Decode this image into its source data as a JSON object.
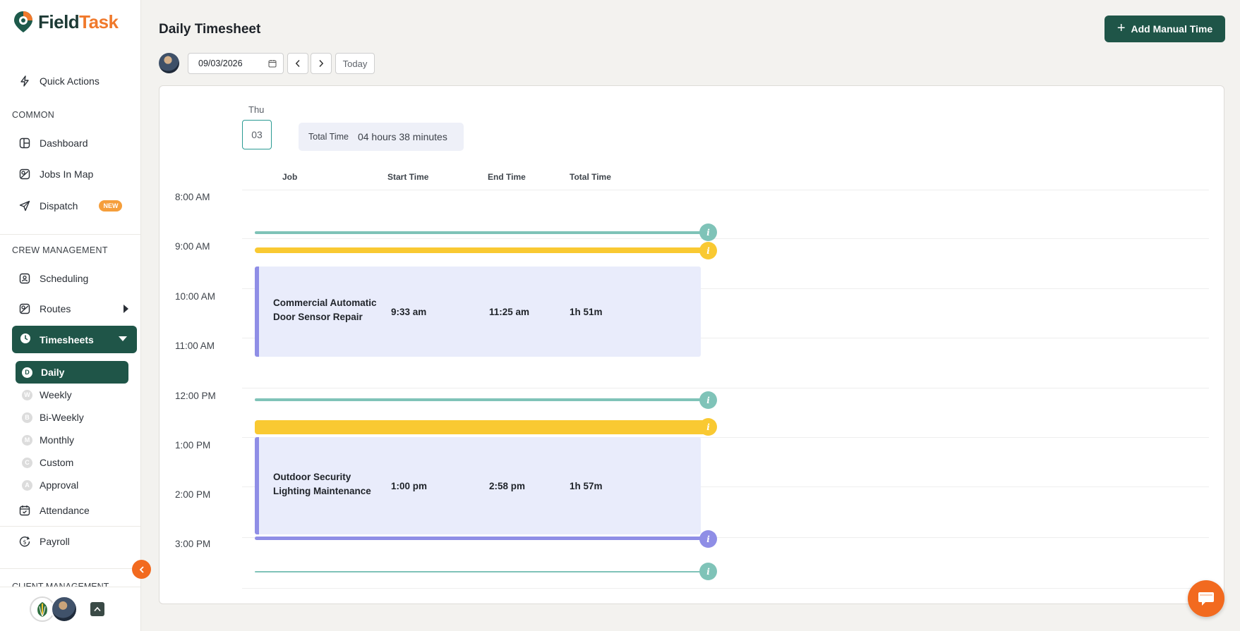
{
  "brand": {
    "name_a": "Field",
    "name_b": "Task"
  },
  "sidebar": {
    "quick_actions": "Quick Actions",
    "common_title": "COMMON",
    "common_items": [
      {
        "label": "Dashboard",
        "icon": "dashboard-icon"
      },
      {
        "label": "Jobs In Map",
        "icon": "map-icon"
      },
      {
        "label": "Dispatch",
        "icon": "send-icon",
        "badge": "NEW"
      }
    ],
    "crew_title": "CREW MANAGEMENT",
    "scheduling": "Scheduling",
    "routes": "Routes",
    "timesheets": "Timesheets",
    "timesheet_sub": [
      {
        "letter": "D",
        "label": "Daily",
        "active": true
      },
      {
        "letter": "W",
        "label": "Weekly"
      },
      {
        "letter": "B",
        "label": "Bi-Weekly"
      },
      {
        "letter": "M",
        "label": "Monthly"
      },
      {
        "letter": "C",
        "label": "Custom"
      },
      {
        "letter": "A",
        "label": "Approval"
      }
    ],
    "attendance": "Attendance",
    "payroll": "Payroll",
    "client_title": "CLIENT MANAGEMENT"
  },
  "header": {
    "title": "Daily Timesheet",
    "add_button": "Add Manual Time",
    "date_value": "09/03/2026",
    "today_button": "Today"
  },
  "day": {
    "name": "Thu",
    "number": "03",
    "total_label": "Total Time",
    "total_value": "04 hours 38 minutes"
  },
  "columns": [
    "Job",
    "Start Time",
    "End Time",
    "Total Time"
  ],
  "time_labels": [
    "8:00 AM",
    "9:00 AM",
    "10:00 AM",
    "11:00 AM",
    "12:00 PM",
    "1:00 PM",
    "2:00 PM",
    "3:00 PM"
  ],
  "entries": [
    {
      "job_line1": "Commercial Automatic",
      "job_line2": "Door Sensor Repair",
      "start": "9:33 am",
      "end": "11:25 am",
      "total": "1h 51m"
    },
    {
      "job_line1": "Outdoor Security",
      "job_line2": "Lighting Maintenance",
      "start": "1:00 pm",
      "end": "2:58 pm",
      "total": "1h 57m"
    }
  ],
  "info_glyph": "i",
  "colors": {
    "primary": "#1f5548",
    "accent": "#f26a1f",
    "teal": "#7fc3b8",
    "yellow": "#f9c932",
    "purple": "#8f8ee6",
    "entry_bg": "#e9ecfb"
  }
}
